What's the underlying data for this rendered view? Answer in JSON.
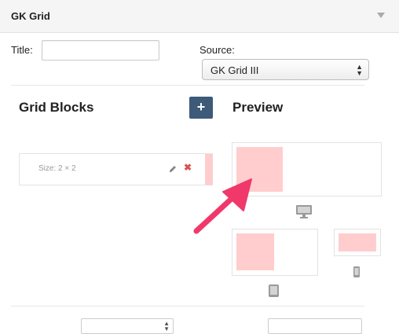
{
  "widget": {
    "title": "GK Grid"
  },
  "form": {
    "title_label": "Title:",
    "title_value": "",
    "source_label": "Source:",
    "source_selected": "GK Grid III"
  },
  "grid_blocks": {
    "heading": "Grid Blocks",
    "add_label": "+",
    "blocks": [
      {
        "size_text": "Size: 2 × 2"
      }
    ]
  },
  "preview": {
    "heading": "Preview",
    "desktop_icon": "desktop-icon",
    "tablet_icon": "tablet-icon",
    "phone_icon": "phone-icon"
  },
  "colors": {
    "accent_button": "#3d5a78",
    "block_fill": "#ffcdcd",
    "delete": "#d9534f",
    "arrow": "#f0386b"
  }
}
